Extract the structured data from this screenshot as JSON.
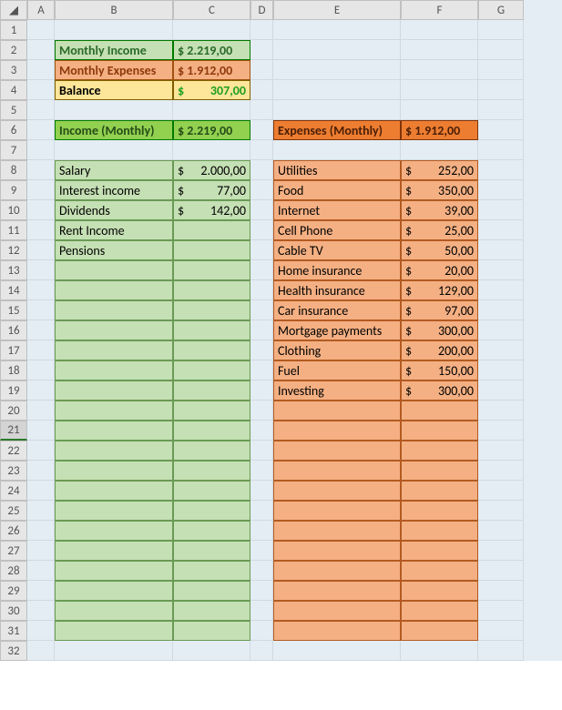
{
  "columns": [
    "A",
    "B",
    "C",
    "D",
    "E",
    "F",
    "G"
  ],
  "rows": 32,
  "selected_row": 21,
  "summary": {
    "income_label": "Monthly Income",
    "income_value": "$ 2.219,00",
    "expenses_label": "Monthly Expenses",
    "expenses_value": "$ 1.912,00",
    "balance_label": "Balance",
    "balance_value_cur": "$",
    "balance_value_num": "307,00"
  },
  "income_header": {
    "label": "Income (Monthly)",
    "value": "$ 2.219,00"
  },
  "expense_header": {
    "label": "Expenses (Monthly)",
    "value": "$ 1.912,00"
  },
  "income_items": [
    {
      "label": "Salary",
      "cur": "$",
      "num": "2.000,00"
    },
    {
      "label": "Interest income",
      "cur": "$",
      "num": "77,00"
    },
    {
      "label": "Dividends",
      "cur": "$",
      "num": "142,00"
    },
    {
      "label": "Rent Income",
      "cur": "",
      "num": ""
    },
    {
      "label": "Pensions",
      "cur": "",
      "num": ""
    },
    {
      "label": "",
      "cur": "",
      "num": ""
    },
    {
      "label": "",
      "cur": "",
      "num": ""
    },
    {
      "label": "",
      "cur": "",
      "num": ""
    },
    {
      "label": "",
      "cur": "",
      "num": ""
    },
    {
      "label": "",
      "cur": "",
      "num": ""
    },
    {
      "label": "",
      "cur": "",
      "num": ""
    },
    {
      "label": "",
      "cur": "",
      "num": ""
    },
    {
      "label": "",
      "cur": "",
      "num": ""
    },
    {
      "label": "",
      "cur": "",
      "num": ""
    },
    {
      "label": "",
      "cur": "",
      "num": ""
    },
    {
      "label": "",
      "cur": "",
      "num": ""
    },
    {
      "label": "",
      "cur": "",
      "num": ""
    },
    {
      "label": "",
      "cur": "",
      "num": ""
    },
    {
      "label": "",
      "cur": "",
      "num": ""
    },
    {
      "label": "",
      "cur": "",
      "num": ""
    },
    {
      "label": "",
      "cur": "",
      "num": ""
    },
    {
      "label": "",
      "cur": "",
      "num": ""
    },
    {
      "label": "",
      "cur": "",
      "num": ""
    },
    {
      "label": "",
      "cur": "",
      "num": ""
    }
  ],
  "expense_items": [
    {
      "label": "Utilities",
      "cur": "$",
      "num": "252,00"
    },
    {
      "label": "Food",
      "cur": "$",
      "num": "350,00"
    },
    {
      "label": "Internet",
      "cur": "$",
      "num": "39,00"
    },
    {
      "label": "Cell Phone",
      "cur": "$",
      "num": "25,00"
    },
    {
      "label": "Cable TV",
      "cur": "$",
      "num": "50,00"
    },
    {
      "label": "Home insurance",
      "cur": "$",
      "num": "20,00"
    },
    {
      "label": "Health insurance",
      "cur": "$",
      "num": "129,00"
    },
    {
      "label": "Car insurance",
      "cur": "$",
      "num": "97,00"
    },
    {
      "label": "Mortgage payments",
      "cur": "$",
      "num": "300,00"
    },
    {
      "label": "Clothing",
      "cur": "$",
      "num": "200,00"
    },
    {
      "label": "Fuel",
      "cur": "$",
      "num": "150,00"
    },
    {
      "label": "Investing",
      "cur": "$",
      "num": "300,00"
    },
    {
      "label": "",
      "cur": "",
      "num": ""
    },
    {
      "label": "",
      "cur": "",
      "num": ""
    },
    {
      "label": "",
      "cur": "",
      "num": ""
    },
    {
      "label": "",
      "cur": "",
      "num": ""
    },
    {
      "label": "",
      "cur": "",
      "num": ""
    },
    {
      "label": "",
      "cur": "",
      "num": ""
    },
    {
      "label": "",
      "cur": "",
      "num": ""
    },
    {
      "label": "",
      "cur": "",
      "num": ""
    },
    {
      "label": "",
      "cur": "",
      "num": ""
    },
    {
      "label": "",
      "cur": "",
      "num": ""
    },
    {
      "label": "",
      "cur": "",
      "num": ""
    },
    {
      "label": "",
      "cur": "",
      "num": ""
    }
  ]
}
